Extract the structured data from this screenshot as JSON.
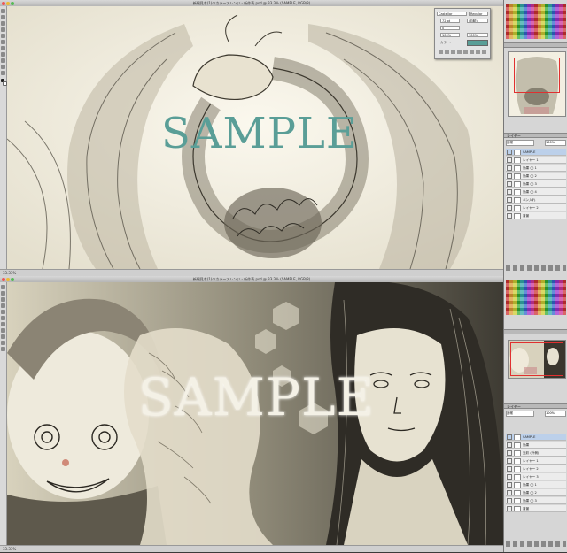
{
  "colors": {
    "watermark_teal": "#5a9e97",
    "watermark_cream": "#f4f1e6",
    "nav_box": "#e03030"
  },
  "top_window": {
    "title": "新規見本(1)のカラーアレンジ - 新作表.psd @ 33.3% (SAMPLE, RGB/8)",
    "watermark": "SAMPLE",
    "status": "33.33%",
    "char_panel": {
      "font": "Castellar",
      "style": "Regular",
      "size": "72 pt",
      "leading": "(自動)",
      "tracking": "0",
      "scale": "100%",
      "color_label": "カラー:"
    },
    "layers_header": "レイヤー",
    "blend_mode": "通常",
    "opacity": "100%",
    "layers": [
      "SAMPLE",
      "レイヤー 1",
      "効果 ◯ 1",
      "効果 ◯ 2",
      "効果 ◯ 3",
      "効果 ◯ 4",
      "ペン入れ",
      "レイヤー 2",
      "背景"
    ]
  },
  "bottom_window": {
    "title": "新規見本(1)のカラーアレンジ - 新作表.psd @ 33.3% (SAMPLE, RGB/8)",
    "watermark": "SAMPLE",
    "status": "33.33%",
    "layers_header": "レイヤー",
    "blend_mode": "通常",
    "opacity": "100%",
    "layers": [
      "SAMPLE",
      "効果",
      "光彩 (外側)",
      "レイヤー 1",
      "レイヤー 2",
      "レイヤー 3",
      "効果 ◯ 1",
      "効果 ◯ 2",
      "効果 ◯ 3",
      "背景"
    ]
  }
}
